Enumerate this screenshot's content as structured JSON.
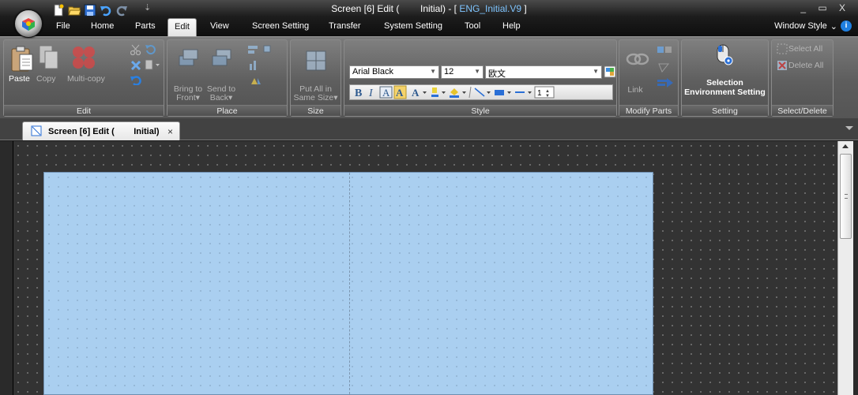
{
  "window": {
    "title_prefix": "Screen [6] Edit (",
    "title_middle": "Initial) - [ ",
    "title_doc": "ENG_Initial.V9",
    "title_suffix": " ]",
    "controls": "_ ▭ X"
  },
  "menu_tabs": [
    "File",
    "Home",
    "Parts",
    "Edit",
    "View",
    "Screen Setting",
    "Transfer",
    "System Setting",
    "Tool",
    "Help"
  ],
  "active_tab": "Edit",
  "window_style_label": "Window Style",
  "window_style_arrow": "⌄",
  "help_glyph": "i",
  "ribbon": {
    "edit_group": {
      "label": "Edit",
      "paste": "Paste",
      "copy": "Copy",
      "multicopy": "Multi-copy"
    },
    "place_group": {
      "label": "Place",
      "bring_front_1": "Bring to",
      "bring_front_2": "Front▾",
      "send_back_1": "Send to",
      "send_back_2": "Back▾"
    },
    "size_group": {
      "label": "Size",
      "put_all_1": "Put All in",
      "put_all_2": "Same Size▾"
    },
    "style_group": {
      "label": "Style",
      "font_name": "Arial Black",
      "font_size": "12",
      "lang": "欧文",
      "line_width": "1"
    },
    "modify_group": {
      "label": "Modify Parts",
      "link": "Link"
    },
    "setting_group": {
      "label": "Setting",
      "selection_1": "Selection",
      "selection_2": "Environment Setting"
    },
    "select_delete_group": {
      "label": "Select/Delete",
      "select_all": "Select All",
      "delete_all": "Delete All"
    }
  },
  "doc_tab": {
    "label": "Screen [6] Edit (        Initial)",
    "close": "×"
  },
  "colors": {
    "screen_bg": "#aacff0",
    "workspace_bg": "#333333",
    "accent": "#1f7fe0"
  }
}
